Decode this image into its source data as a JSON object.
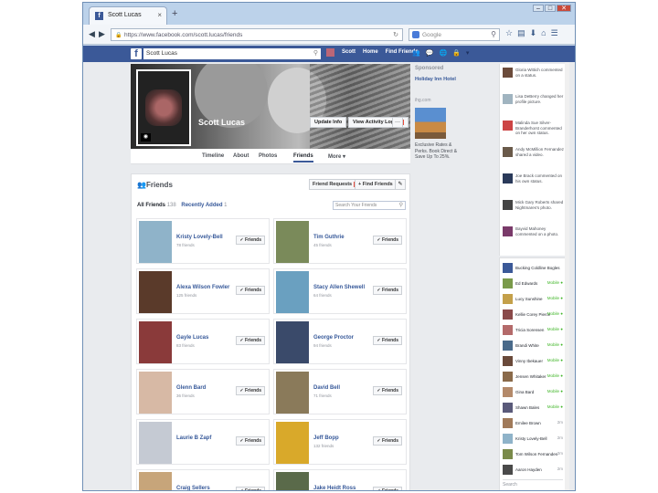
{
  "browser": {
    "tab_title": "Scott Lucas",
    "tab_close": "×",
    "new_tab": "+",
    "url": "https://www.facebook.com/scott.lucas/friends",
    "search_placeholder": "Google",
    "win_min": "–",
    "win_max": "□",
    "win_close": "✕",
    "back": "◀",
    "forward": "▶",
    "toolbar_icons": [
      "☆",
      "▤",
      "⬇",
      "⌂",
      "☰"
    ]
  },
  "fb": {
    "logo": "f",
    "search_value": "Scott Lucas",
    "nav": [
      "Scott",
      "Home",
      "Find Friends"
    ],
    "top_icons": [
      "👥",
      "💬",
      "🌐",
      "🔒",
      "▾"
    ]
  },
  "profile": {
    "name": "Scott Lucas",
    "update_info": "Update Info",
    "view_activity": "View Activity Log",
    "activity_badge": "10",
    "more": "···",
    "tabs": [
      "Timeline",
      "About",
      "Photos",
      "Friends",
      "More ▾"
    ]
  },
  "friends": {
    "heading": "Friends",
    "requests_label": "Friend Requests",
    "requests_badge": "2",
    "find_label": "+ Find Friends",
    "edit": "✎",
    "filter_all": "All Friends",
    "filter_count": "138",
    "filter_recent": "Recently Added",
    "filter_recent_count": "1",
    "search_placeholder": "Search Your Friends",
    "button_label": "✓ Friends",
    "cards": [
      {
        "name": "Kristy Lovely-Bell",
        "sub": "78 friends",
        "color": "#8fb3c9"
      },
      {
        "name": "Tim Guthrie",
        "sub": "45 friends",
        "color": "#7a8a5a"
      },
      {
        "name": "Alexa Wilson Fowler",
        "sub": "125 friends",
        "color": "#5a3a2a"
      },
      {
        "name": "Stacy Allen Shewell",
        "sub": "64 friends",
        "color": "#6aa0c0"
      },
      {
        "name": "Gayle Lucas",
        "sub": "83 friends",
        "color": "#8a3a3a"
      },
      {
        "name": "George Proctor",
        "sub": "94 friends",
        "color": "#3a4a6a"
      },
      {
        "name": "Glenn Bard",
        "sub": "36 friends",
        "color": "#d7b9a5"
      },
      {
        "name": "David Bell",
        "sub": "71 friends",
        "color": "#8a7a5a"
      },
      {
        "name": "Laurie B Zapf",
        "sub": "",
        "color": "#c5cad3"
      },
      {
        "name": "Jeff Bopp",
        "sub": "132 friends",
        "color": "#d9a92a"
      },
      {
        "name": "Craig Sellers",
        "sub": "47 friends",
        "color": "#c7a57a"
      },
      {
        "name": "Jake Heidt Ross",
        "sub": "56 friends",
        "color": "#5a6a4a"
      }
    ]
  },
  "sponsored": {
    "heading": "Sponsored",
    "title": "Holiday Inn Hotel",
    "url": "ihg.com",
    "text": "Exclusive Rates & Perks. Book Direct & Save Up To 25%."
  },
  "ticker": [
    {
      "text": "Gloria Wittich commented on a status.",
      "color": "#6b4b3b"
    },
    {
      "text": "Lisa DeBerry changed her profile picture.",
      "color": "#a0b4c0"
    },
    {
      "text": "Malinda Sue Silver-Branderhorst commented on her own status.",
      "color": "#c44"
    },
    {
      "text": "Andy McMillion Fernandez shared a video.",
      "color": "#6a5a4a"
    },
    {
      "text": "Joe Brack commented on his own status.",
      "color": "#2a3a5a"
    },
    {
      "text": "Mick Gary Roberts shared Nightmares's photo.",
      "color": "#444"
    },
    {
      "text": "Bayvid Mahoney commented on a photo.",
      "color": "#7a3a6a"
    }
  ],
  "chat": [
    {
      "name": "Bucking Coldline Bogles",
      "status": "",
      "color": "#3b5998"
    },
    {
      "name": "Ed Edwards",
      "status": "Mobile ●",
      "color": "#7a9a4a"
    },
    {
      "name": "Lucy Sunshine",
      "status": "Mobile ●",
      "color": "#c4a04a"
    },
    {
      "name": "Kellie Corey Pierce",
      "status": "Mobile ●",
      "color": "#8a4a4a"
    },
    {
      "name": "Tricia Sorensen",
      "status": "Mobile ●",
      "color": "#b46a6a"
    },
    {
      "name": "Brandi White",
      "status": "Mobile ●",
      "color": "#4a6a8a"
    },
    {
      "name": "Vinny Ibekauer",
      "status": "Mobile ●",
      "color": "#6a4a3a"
    },
    {
      "name": "Jensen Whitaker",
      "status": "Mobile ●",
      "color": "#8a6a4a"
    },
    {
      "name": "Gina Bard",
      "status": "Mobile ●",
      "color": "#b48a6a"
    },
    {
      "name": "Shawn Bales",
      "status": "Mobile ●",
      "color": "#5a5a7a"
    },
    {
      "name": "Emilee Brown",
      "status": "2m",
      "color": "#a07a5a"
    },
    {
      "name": "Kristy Lovely-Bell",
      "status": "2m",
      "color": "#8fb3c9"
    },
    {
      "name": "Tom Wilson Fernandes",
      "status": "2m",
      "color": "#7a8a4a"
    },
    {
      "name": "Aaron Hayden",
      "status": "2m",
      "color": "#4a4a4a"
    }
  ],
  "chat_search": "Search"
}
